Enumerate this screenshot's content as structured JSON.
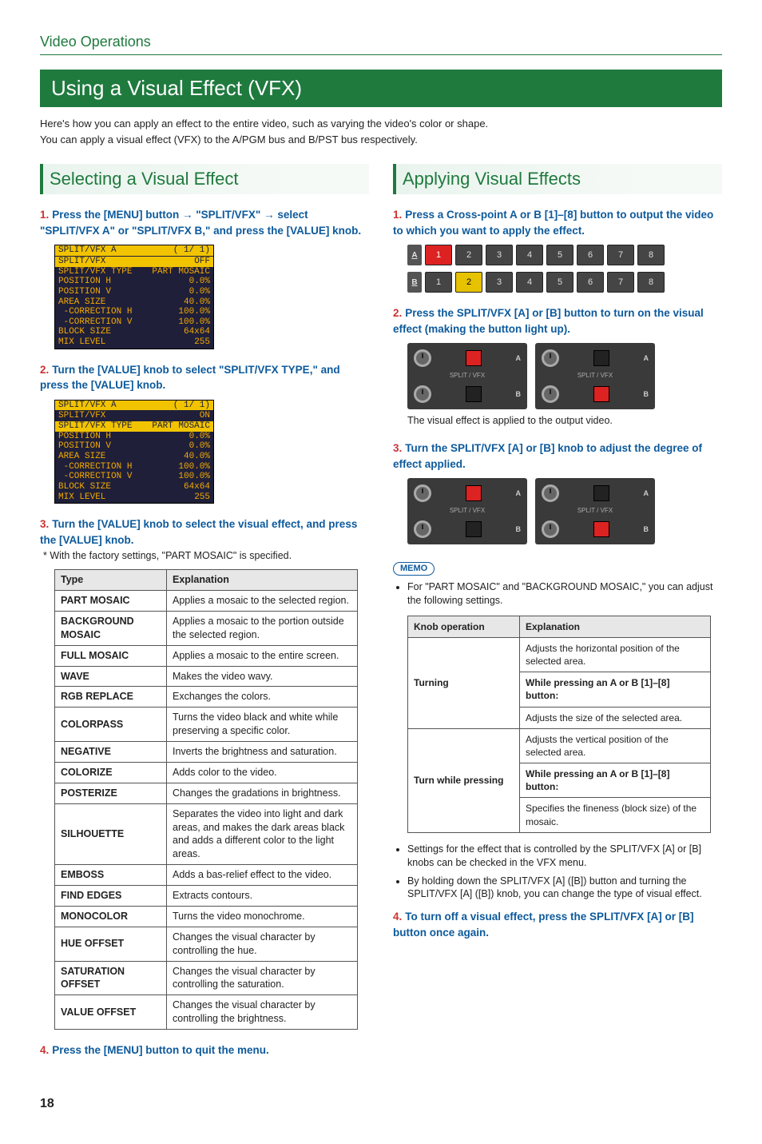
{
  "section_label": "Video Operations",
  "title": "Using a Visual Effect (VFX)",
  "intro": [
    "Here's how you can apply an effect to the entire video, such as varying the video's color or shape.",
    "You can apply a visual effect (VFX) to the A/PGM bus and B/PST bus respectively."
  ],
  "left": {
    "heading": "Selecting a Visual Effect",
    "step1": {
      "num": "1.",
      "text": "Press the [MENU] button → \"SPLIT/VFX\" → select \"SPLIT/VFX A\" or \"SPLIT/VFX B,\" and press the [VALUE] knob."
    },
    "screen1_title": {
      "k": "SPLIT/VFX A",
      "v": "( 1/ 1)"
    },
    "screen1": [
      {
        "k": "SPLIT/VFX",
        "v": "OFF",
        "inv": true
      },
      {
        "k": "SPLIT/VFX TYPE",
        "v": "PART MOSAIC"
      },
      {
        "k": "POSITION H",
        "v": "0.0%"
      },
      {
        "k": "POSITION V",
        "v": "0.0%"
      },
      {
        "k": "AREA SIZE",
        "v": "40.0%"
      },
      {
        "k": " -CORRECTION H",
        "v": "100.0%"
      },
      {
        "k": " -CORRECTION V",
        "v": "100.0%"
      },
      {
        "k": "BLOCK SIZE",
        "v": "64x64"
      },
      {
        "k": "MIX LEVEL",
        "v": "255"
      }
    ],
    "step2": {
      "num": "2.",
      "text": "Turn the [VALUE] knob to select \"SPLIT/VFX TYPE,\" and press the [VALUE] knob."
    },
    "screen2_title": {
      "k": "SPLIT/VFX A",
      "v": "( 1/ 1)"
    },
    "screen2": [
      {
        "k": "SPLIT/VFX",
        "v": "ON"
      },
      {
        "k": "SPLIT/VFX TYPE",
        "v": "PART MOSAIC",
        "inv": true
      },
      {
        "k": "POSITION H",
        "v": "0.0%"
      },
      {
        "k": "POSITION V",
        "v": "0.0%"
      },
      {
        "k": "AREA SIZE",
        "v": "40.0%"
      },
      {
        "k": " -CORRECTION H",
        "v": "100.0%"
      },
      {
        "k": " -CORRECTION V",
        "v": "100.0%"
      },
      {
        "k": "BLOCK SIZE",
        "v": "64x64"
      },
      {
        "k": "MIX LEVEL",
        "v": "255"
      }
    ],
    "step3": {
      "num": "3.",
      "text": "Turn the [VALUE] knob to select the visual effect, and press the [VALUE] knob."
    },
    "step3_note": "*  With the factory settings, \"PART MOSAIC\" is specified.",
    "table_headers": [
      "Type",
      "Explanation"
    ],
    "table_rows": [
      [
        "PART MOSAIC",
        "Applies a mosaic to the selected region."
      ],
      [
        "BACKGROUND MOSAIC",
        "Applies a mosaic to the portion outside the selected region."
      ],
      [
        "FULL MOSAIC",
        "Applies a mosaic to the entire screen."
      ],
      [
        "WAVE",
        "Makes the video wavy."
      ],
      [
        "RGB REPLACE",
        "Exchanges the colors."
      ],
      [
        "COLORPASS",
        "Turns the video black and white while preserving a specific color."
      ],
      [
        "NEGATIVE",
        "Inverts the brightness and saturation."
      ],
      [
        "COLORIZE",
        "Adds color to the video."
      ],
      [
        "POSTERIZE",
        "Changes the gradations in brightness."
      ],
      [
        "SILHOUETTE",
        "Separates the video into light and dark areas, and makes the dark areas black and adds a different color to the light areas."
      ],
      [
        "EMBOSS",
        "Adds a bas-relief effect to the video."
      ],
      [
        "FIND EDGES",
        "Extracts contours."
      ],
      [
        "MONOCOLOR",
        "Turns the video monochrome."
      ],
      [
        "HUE OFFSET",
        "Changes the visual character by controlling the hue."
      ],
      [
        "SATURATION OFFSET",
        "Changes the visual character by controlling the saturation."
      ],
      [
        "VALUE OFFSET",
        "Changes the visual character by controlling the brightness."
      ]
    ],
    "step4": {
      "num": "4.",
      "text": "Press the [MENU] button to quit the menu."
    }
  },
  "right": {
    "heading": "Applying Visual Effects",
    "step1": {
      "num": "1.",
      "text": "Press a Cross-point A or B [1]–[8] button to output the video to which you want to apply the effect."
    },
    "rowA_label": "A",
    "rowB_label": "B",
    "rowA": [
      "1",
      "2",
      "3",
      "4",
      "5",
      "6",
      "7",
      "8"
    ],
    "rowB": [
      "1",
      "2",
      "3",
      "4",
      "5",
      "6",
      "7",
      "8"
    ],
    "step2": {
      "num": "2.",
      "text": "Press the SPLIT/VFX [A] or [B] button to turn on the visual effect (making the button light up)."
    },
    "split_label": "SPLIT / VFX",
    "panel_a": "A",
    "panel_b": "B",
    "step2_body": "The visual effect is applied to the output video.",
    "step3": {
      "num": "3.",
      "text": "Turn the SPLIT/VFX [A] or [B] knob to adjust the degree of effect applied."
    },
    "memo_label": "MEMO",
    "memo_bullet1": "For \"PART MOSAIC\" and \"BACKGROUND MOSAIC,\" you can adjust the following settings.",
    "knob_headers": [
      "Knob operation",
      "Explanation"
    ],
    "knob_rows": [
      {
        "op": "Turning",
        "lines": [
          "Adjusts the horizontal position of the selected area.",
          "While pressing an A or B [1]–[8] button:",
          "Adjusts the size of the selected area."
        ]
      },
      {
        "op": "Turn while pressing",
        "lines": [
          "Adjusts the vertical position of the selected area.",
          "While pressing an A or B [1]–[8] button:",
          "Specifies the fineness (block size) of the mosaic."
        ]
      }
    ],
    "memo_bullet2": "Settings for the effect that is controlled by the SPLIT/VFX [A] or [B] knobs can be checked in the VFX menu.",
    "memo_bullet3": "By holding down the SPLIT/VFX [A] ([B]) button and turning the SPLIT/VFX [A] ([B]) knob, you can change the type of visual effect.",
    "step4": {
      "num": "4.",
      "text": "To turn off a visual effect, press the SPLIT/VFX [A] or [B] button once again."
    }
  },
  "page_number": "18"
}
